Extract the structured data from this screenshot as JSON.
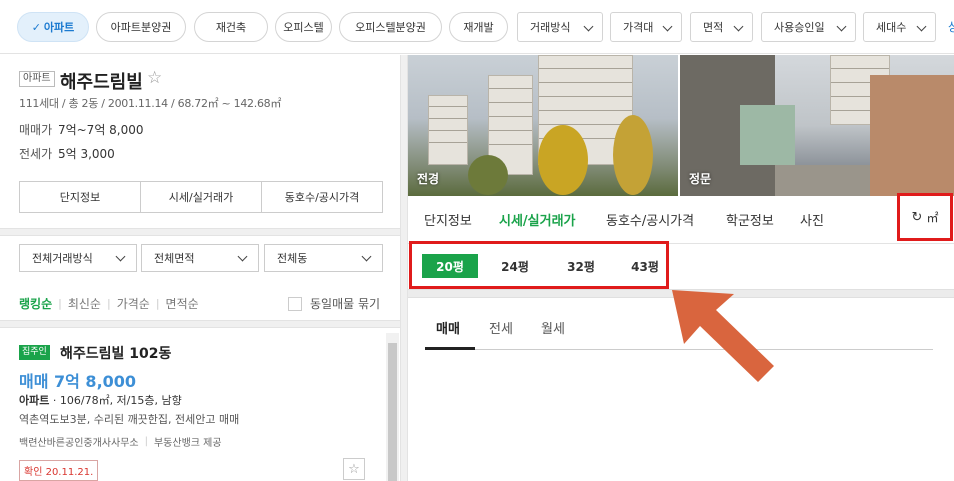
{
  "filters": {
    "pills": [
      "아파트",
      "아파트분양권",
      "재건축",
      "오피스텔",
      "오피스텔분양권",
      "재개발"
    ],
    "active_check": "✓",
    "dropdowns": [
      "거래방식",
      "가격대",
      "면적",
      "사용승인일",
      "세대수"
    ],
    "edge_text": "상"
  },
  "complex": {
    "type_badge": "아파트",
    "name": "해주드림빌",
    "star": "☆",
    "info": "111세대 / 총 2동 / 2001.11.14 / 68.72㎡ ~ 142.68㎡",
    "sale_label": "매매가",
    "sale_value": "7억~7억 8,000",
    "jeonse_label": "전세가",
    "jeonse_value": "5억 3,000",
    "tabs": [
      "단지정보",
      "시세/실거래가",
      "동호수/공시가격"
    ]
  },
  "selects": [
    "전체거래방식",
    "전체면적",
    "전체동"
  ],
  "sort": {
    "options": [
      "랭킹순",
      "최신순",
      "가격순",
      "면적순"
    ],
    "active": "랭킹순",
    "bundle_label": "동일매물 묶기"
  },
  "listing": {
    "owner_badge": "집주인",
    "title": "해주드림빌 102동",
    "price": "매매 7억 8,000",
    "spec_type": "아파트",
    "spec_rest": " · 106/78㎡, 저/15층, 남향",
    "desc": "역촌역도보3분, 수리된 깨끗한집, 전세안고 매매",
    "agent": "백련산바른공인중개사사무소",
    "provider": "부동산뱅크 제공",
    "confirm": "확인 20.11.21.",
    "star": "☆"
  },
  "photos": {
    "caption1": "전경",
    "caption2": "정문"
  },
  "detail_tabs": [
    "단지정보",
    "시세/실거래가",
    "동호수/공시가격",
    "학군정보",
    "사진"
  ],
  "detail_active": "시세/실거래가",
  "unit_toggle": {
    "icon": "↻",
    "unit": "㎡"
  },
  "pyeong": {
    "options": [
      "20평",
      "24평",
      "32평",
      "43평"
    ],
    "active": "20평"
  },
  "trade_tabs": {
    "options": [
      "매매",
      "전세",
      "월세"
    ],
    "active": "매매"
  },
  "colors": {
    "green": "#1aa34a",
    "blue": "#3d8fd6",
    "highlight_red": "#e01b1b",
    "arrow_orange": "#d9653e"
  }
}
